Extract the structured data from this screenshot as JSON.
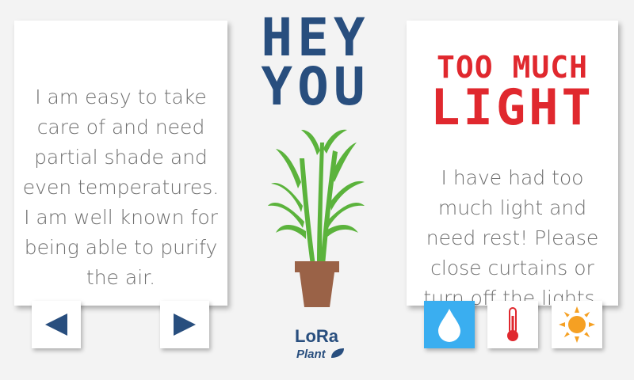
{
  "heading": {
    "line1": "HEY",
    "line2": "YOU"
  },
  "info_card": {
    "text": "I am easy to take care of and need partial shade and even temperatures. I am well known for being able to purify the air."
  },
  "alert_card": {
    "title_line1": "TOO MUCH",
    "title_line2": "LIGHT",
    "text": "I have had too much light and need rest! Please close curtains or turn off the lights."
  },
  "nav": {
    "prev_icon": "triangle-left-icon",
    "next_icon": "triangle-right-icon"
  },
  "status_buttons": [
    {
      "name": "water",
      "icon": "water-drop-icon",
      "active": true
    },
    {
      "name": "temperature",
      "icon": "thermometer-icon",
      "active": false
    },
    {
      "name": "light",
      "icon": "sun-icon",
      "active": false
    }
  ],
  "logo": {
    "line1": "LoRa",
    "line2": "Plant"
  },
  "colors": {
    "background": "#f3f3f3",
    "heading_blue": "#284e7e",
    "alert_red": "#e0282e",
    "text_gray": "#6f6f6f",
    "water_active": "#3aaef0",
    "leaf_green": "#5bb33c",
    "pot_brown": "#9a6247",
    "sun_orange": "#f5a023"
  }
}
